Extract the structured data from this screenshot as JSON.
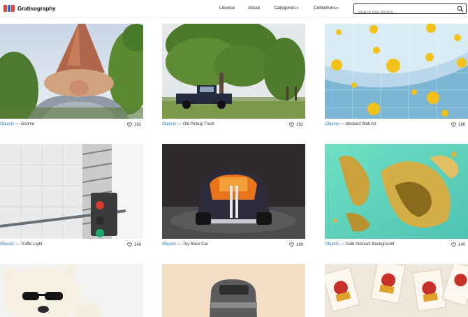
{
  "header": {
    "logo_text": "Gratisography",
    "nav": [
      {
        "label": "License",
        "caret": false
      },
      {
        "label": "About",
        "caret": false
      },
      {
        "label": "Categories",
        "caret": true
      },
      {
        "label": "Collections",
        "caret": true
      }
    ],
    "search_placeholder": "Search free photos...",
    "caret_glyph": "▾"
  },
  "photos": [
    {
      "category": "Objects",
      "title": "Gnome",
      "likes": "192"
    },
    {
      "category": "Objects",
      "title": "Old Pickup Truck",
      "likes": "192"
    },
    {
      "category": "Objects",
      "title": "Abstract Wall Art",
      "likes": "186"
    },
    {
      "category": "Objects",
      "title": "Traffic Light",
      "likes": "148"
    },
    {
      "category": "Objects",
      "title": "Toy Race Car",
      "likes": "169"
    },
    {
      "category": "Objects",
      "title": "Gold Abstract Background",
      "likes": "140"
    }
  ],
  "separator": " — "
}
